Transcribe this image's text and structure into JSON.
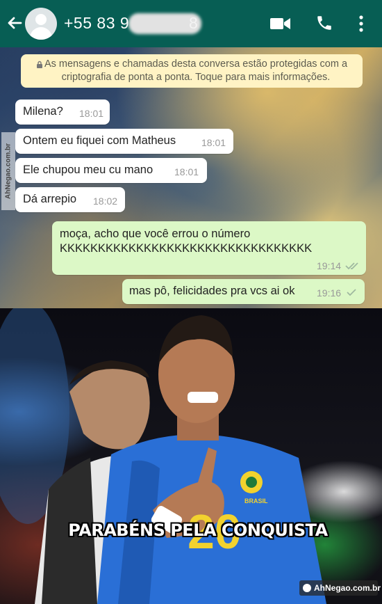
{
  "header": {
    "phone_number": "+55 83 9",
    "phone_redacted_tail": "8"
  },
  "notice": {
    "text": "As mensagens e chamadas desta conversa estão protegidas com a criptografia de ponta a ponta. Toque para mais informações."
  },
  "messages": [
    {
      "direction": "in",
      "text": "Milena?",
      "time": "18:01"
    },
    {
      "direction": "in",
      "text": "Ontem eu fiquei com Matheus",
      "time": "18:01"
    },
    {
      "direction": "in",
      "text": "Ele chupou meu cu mano",
      "time": "18:01"
    },
    {
      "direction": "in",
      "text": "Dá arrepio",
      "time": "18:02"
    },
    {
      "direction": "out",
      "text_line1": "moça, acho que você errou o número",
      "text_line2": "KKKKKKKKKKKKKKKKKKKKKKKKKKKKKKKKK",
      "time": "19:14",
      "status": "read"
    },
    {
      "direction": "out",
      "text": "mas pô, felicidades pra vcs ai ok",
      "time": "19:16",
      "status": "sent"
    }
  ],
  "watermarks": {
    "side": "AhNegao.com.br",
    "bottom": "AhNegao.com.br"
  },
  "meme": {
    "caption": "PARABÉNS PELA CONQUISTA",
    "jersey_text": "BRASIL",
    "jersey_number": "20"
  },
  "colors": {
    "header": "#075e54",
    "incoming_bubble": "#ffffff",
    "outgoing_bubble": "#dcf8c6",
    "notice_bg": "#fff3c4",
    "read_ticks": "#9fb8a0",
    "jersey_blue": "#2a6fd6",
    "jersey_yellow": "#f2d22e"
  }
}
